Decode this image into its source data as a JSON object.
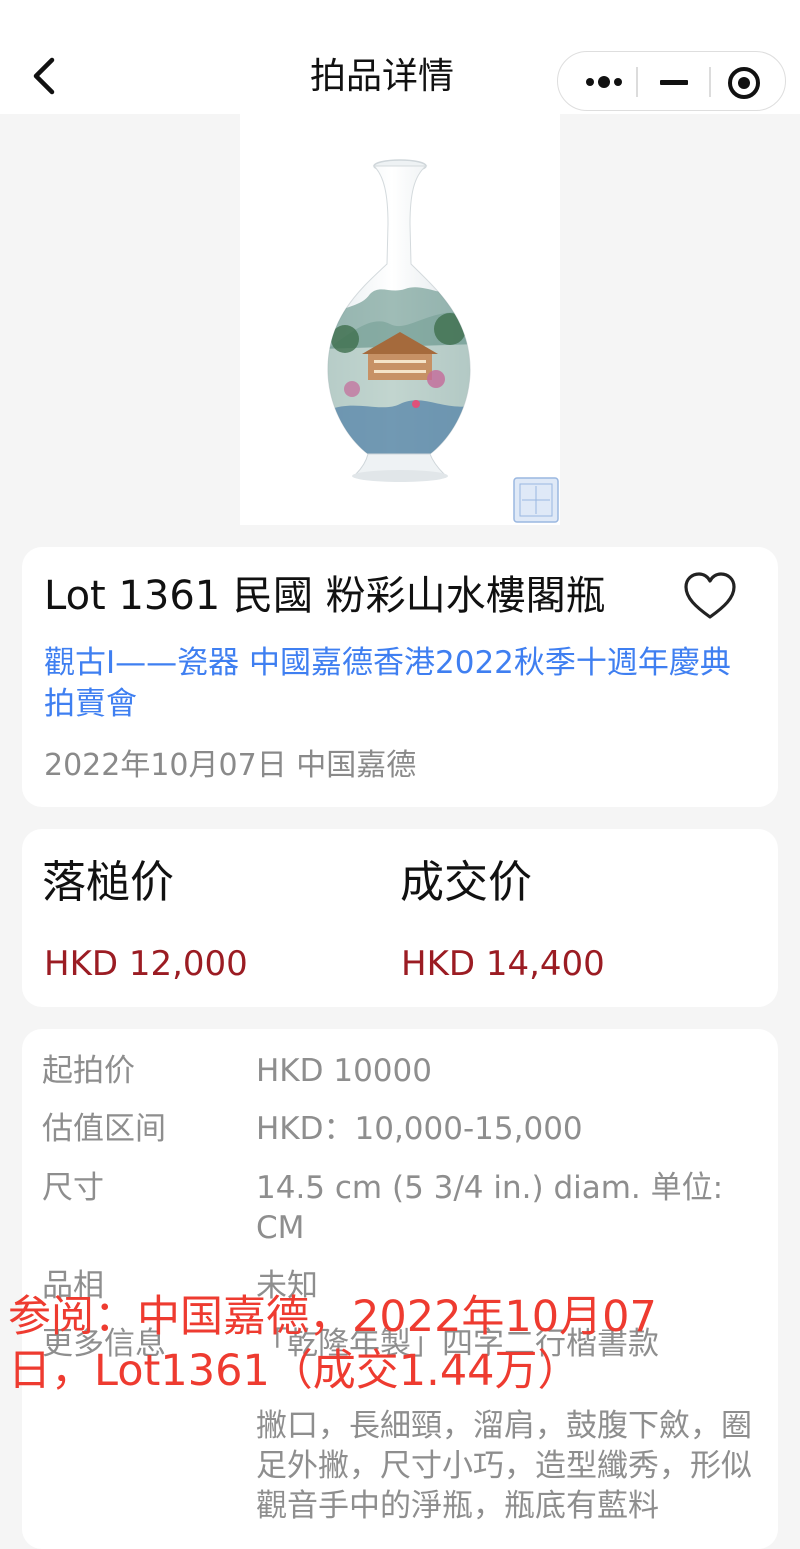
{
  "nav": {
    "title": "拍品详情",
    "back_icon": "chevron-left-icon",
    "capsule": [
      "more-dots-icon",
      "minimize-icon",
      "close-circle-icon"
    ]
  },
  "lot": {
    "title": "Lot 1361 民國 粉彩山水樓閣瓶",
    "sale": "觀古I——瓷器 中國嘉德香港2022秋季十週年慶典拍賣會",
    "meta": "2022年10月07日 中国嘉德",
    "favorite_icon": "heart-outline-icon"
  },
  "prices": {
    "hammer_label": "落槌价",
    "hammer_value": "HKD 12,000",
    "deal_label": "成交价",
    "deal_value": "HKD 14,400"
  },
  "details": [
    {
      "key": "起拍价",
      "value": "HKD 10000"
    },
    {
      "key": "估值区间",
      "value": "HKD：10,000-15,000"
    },
    {
      "key": "尺寸",
      "value": "14.5 cm (5 3/4 in.) diam. 单位: CM"
    },
    {
      "key": "品相",
      "value": "未知"
    },
    {
      "key": "更多信息",
      "value": "「乾隆年製」四字二行楷書款"
    }
  ],
  "description": "撇口，長細頸，溜肩，鼓腹下斂，圈足外撇，尺寸小巧，造型纖秀，形似觀音手中的淨瓶，瓶底有藍料",
  "overlay_note": "参阅：中国嘉德，2022年10月07日，Lot1361（成交1.44万）",
  "colors": {
    "accent_link": "#3f7ff1",
    "price": "#9b1c23",
    "overlay": "#ee3b30"
  }
}
